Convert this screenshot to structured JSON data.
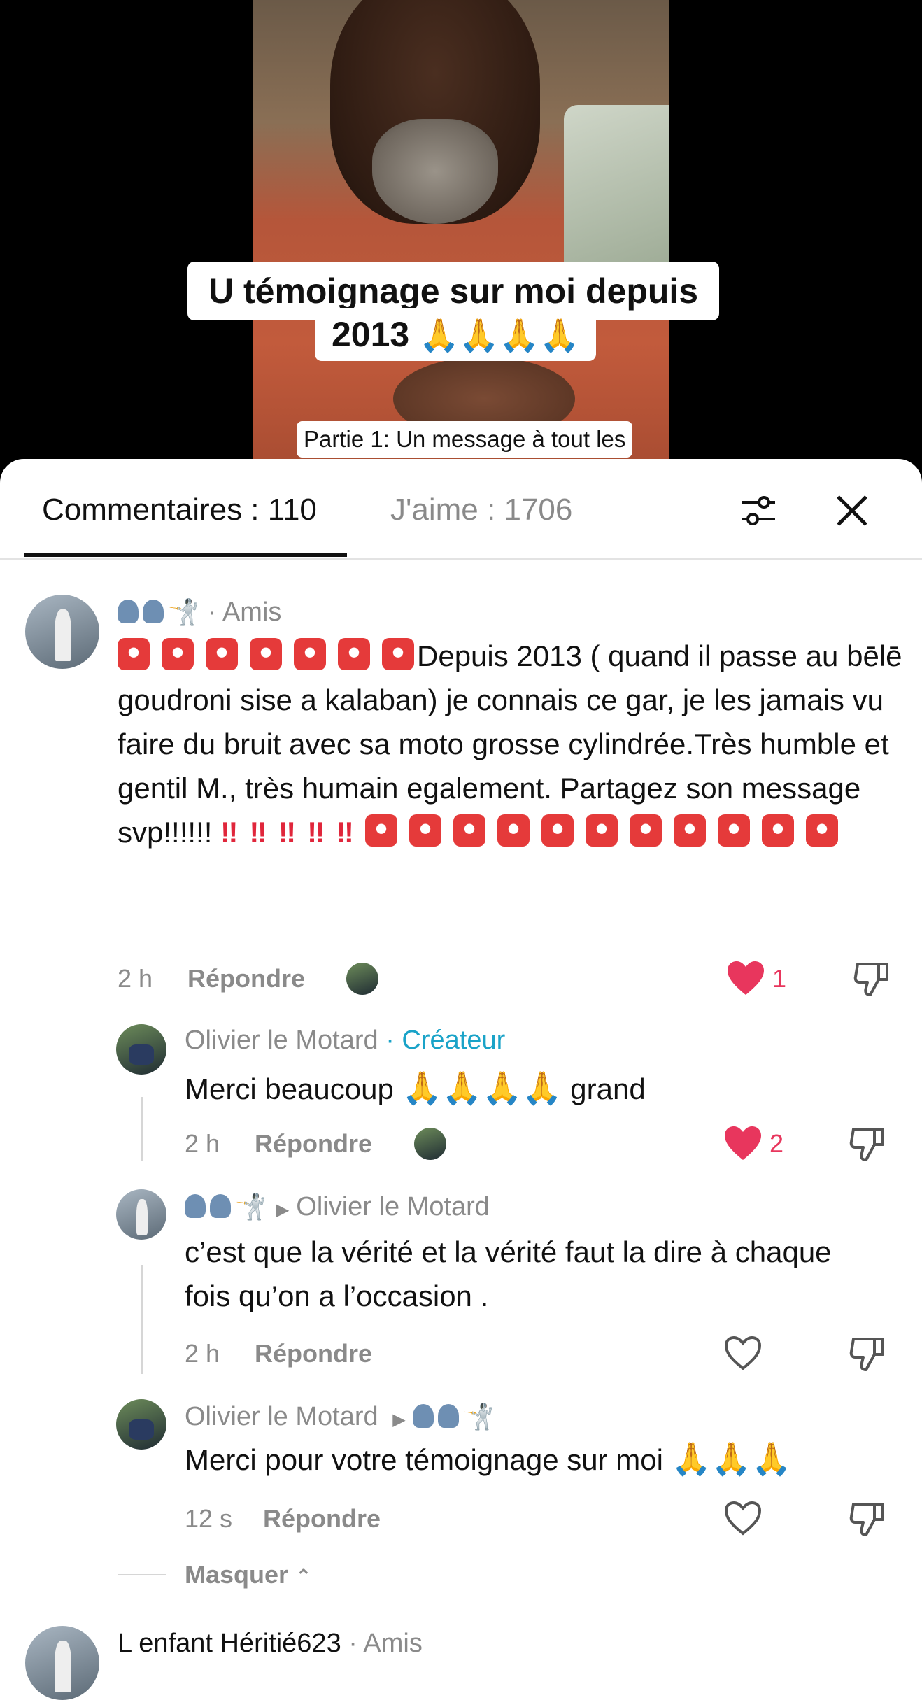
{
  "video": {
    "caption_line1": "U témoignage sur moi depuis",
    "caption_line2": "2013",
    "caption_emoji": "🙏🙏🙏🙏",
    "subtitle": "Partie 1: Un message à tout les"
  },
  "tabs": {
    "comments": "Commentaires : 110",
    "likes": "J'aime : 1706"
  },
  "icons": [
    "filter-icon",
    "close-icon",
    "heart-icon",
    "dislike-icon",
    "siren-icon",
    "pray-icon"
  ],
  "colors": {
    "like": "#e8365d",
    "creator": "#1aa3c8",
    "muted": "#8a8a8a"
  },
  "comments": [
    {
      "author_suffix": "· Amis",
      "text_prefix": "",
      "text_main": "Depuis 2013 ( quand il passe au bēlē goudroni sise a kalaban) je connais ce gar, je les jamais vu faire du bruit avec sa moto grosse cylindrée.Très humble et gentil M., très humain egalement. Partagez son message svp!!!!!!",
      "bangs": "‼",
      "time": "2 h",
      "reply": "Répondre",
      "likes": "1"
    },
    {
      "author": "Olivier le Motard",
      "badge": "· Créateur",
      "text": "Merci beaucoup",
      "text_end": "grand",
      "time": "2 h",
      "reply": "Répondre",
      "likes": "2"
    },
    {
      "reply_to": "Olivier le Motard",
      "text": "c’est que la vérité et la vérité faut la dire à chaque fois qu’on a l’occasion .",
      "time": "2 h",
      "reply": "Répondre"
    },
    {
      "author": "Olivier le Motard",
      "text": "Merci pour votre témoignage sur moi",
      "time": "12 s",
      "reply": "Répondre"
    }
  ],
  "hide": "Masquer",
  "next_comment": {
    "author": "L enfant Héritié623",
    "suffix": "· Amis"
  }
}
